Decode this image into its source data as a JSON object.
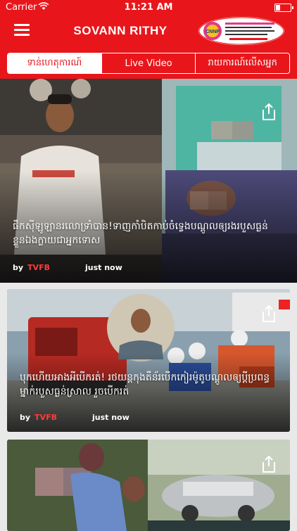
{
  "status_bar": {
    "carrier": "Carrier",
    "time": "11:21 AM",
    "battery_level": 0.3,
    "wifi_icon": "wifi-icon"
  },
  "header": {
    "title": "SOVANN RITHY",
    "menu_icon": "hamburger-icon",
    "logo_text": "CNNP",
    "accent": "#e8161b"
  },
  "tabs": [
    {
      "label": "ទាន់ហេតុការណ៍",
      "active": true
    },
    {
      "label": "Live Video",
      "active": false
    },
    {
      "label": "រាយការណ៍លើសអ្នក",
      "active": false
    }
  ],
  "articles": [
    {
      "headline": "ផឹកស៊ីឡូឡានរលោទ្រាំបាន!ទាញកាំបិតកាប់ចំទ្វេងបណ្តូលឲ្យរងរបួសធ្ងន់ ខ្លួនឯងក្លាយជាអ្នកទោស",
      "by": "by",
      "author": "TVFB",
      "time": "just now",
      "share_icon": "share-icon"
    },
    {
      "headline": "បុកហើយអាងអីបើករត់! រថយន្តកុងតឺន័របើកកៀរម៉ូតូបណ្តូលឲ្យប្តីប្រពន្ធម្នាក់របួសធ្ងន់ស្រាល រួចបើករត់",
      "by": "by",
      "author": "TVFB",
      "time": "just now",
      "share_icon": "share-icon"
    },
    {
      "headline": "",
      "share_icon": "share-icon"
    }
  ]
}
